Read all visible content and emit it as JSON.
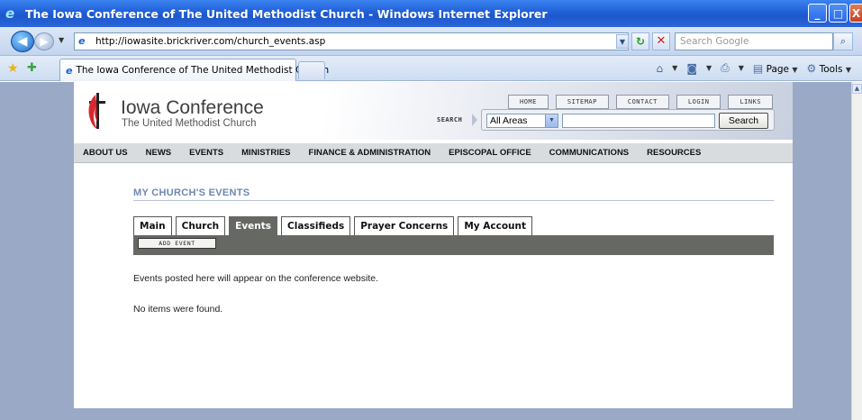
{
  "window": {
    "title": "The Iowa Conference of The United Methodist Church - Windows Internet Explorer",
    "buttons": {
      "minimize": "_",
      "maximize": "□",
      "close": "X"
    }
  },
  "browser": {
    "url": "http://iowasite.brickriver.com/church_events.asp",
    "search_placeholder": "Search Google",
    "tab_title": "The Iowa Conference of The United Methodist Church",
    "commands": {
      "page": "Page",
      "tools": "Tools"
    }
  },
  "site": {
    "logo_title": "Iowa Conference",
    "logo_subtitle": "The United Methodist Church",
    "toplinks": [
      "HOME",
      "SITEMAP",
      "CONTACT",
      "LOGIN",
      "LINKS"
    ],
    "search_label": "SEARCH",
    "search_scope": "All Areas",
    "search_button": "Search",
    "nav": [
      "ABOUT US",
      "NEWS",
      "EVENTS",
      "MINISTRIES",
      "FINANCE & ADMINISTRATION",
      "EPISCOPAL OFFICE",
      "COMMUNICATIONS",
      "RESOURCES"
    ],
    "brand_color": "#d7282f"
  },
  "content": {
    "heading": "MY CHURCH'S EVENTS",
    "tabs": [
      "Main",
      "Church",
      "Events",
      "Classifieds",
      "Prayer Concerns",
      "My Account"
    ],
    "active_tab": "Events",
    "add_event": "ADD EVENT",
    "note_posted": "Events posted here will appear on the conference website.",
    "note_empty": "No items were found."
  }
}
